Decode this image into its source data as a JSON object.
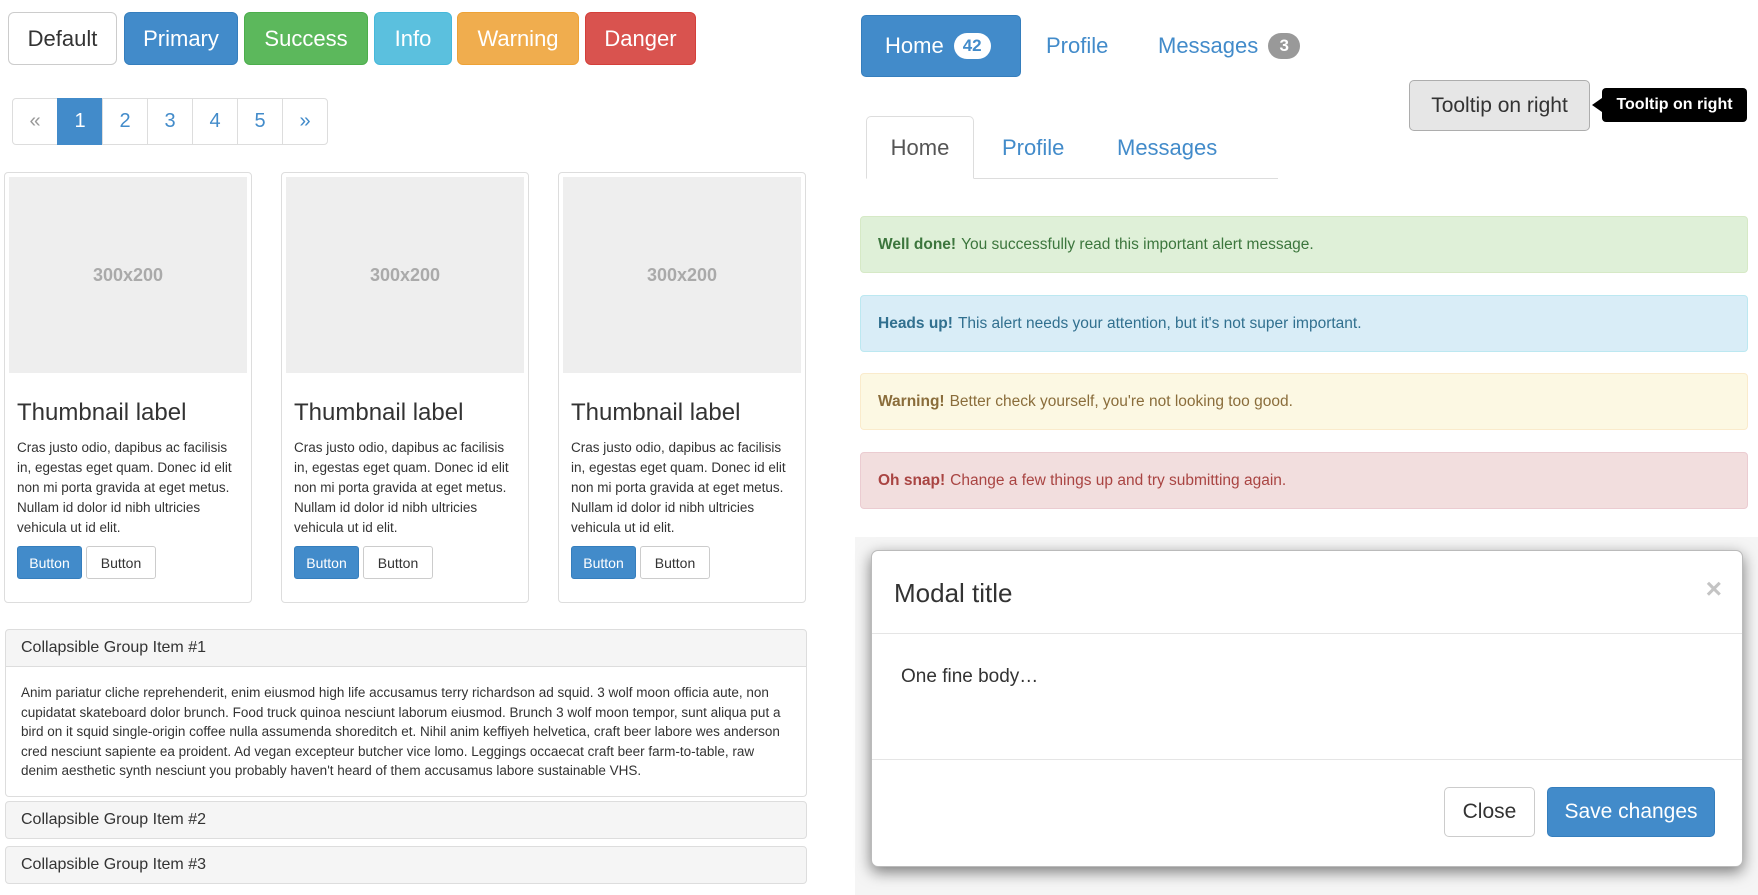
{
  "buttons": {
    "default": "Default",
    "primary": "Primary",
    "success": "Success",
    "info": "Info",
    "warning": "Warning",
    "danger": "Danger"
  },
  "pagination": {
    "prev": "«",
    "pages": [
      "1",
      "2",
      "3",
      "4",
      "5"
    ],
    "next": "»",
    "active_page": "1"
  },
  "thumbnails": [
    {
      "image_text": "300x200",
      "label": "Thumbnail label",
      "text": "Cras justo odio, dapibus ac facilisis in, egestas eget quam. Donec id elit non mi porta gravida at eget metus. Nullam id dolor id nibh ultricies vehicula ut id elit.",
      "primary_button": "Button",
      "default_button": "Button"
    },
    {
      "image_text": "300x200",
      "label": "Thumbnail label",
      "text": "Cras justo odio, dapibus ac facilisis in, egestas eget quam. Donec id elit non mi porta gravida at eget metus. Nullam id dolor id nibh ultricies vehicula ut id elit.",
      "primary_button": "Button",
      "default_button": "Button"
    },
    {
      "image_text": "300x200",
      "label": "Thumbnail label",
      "text": "Cras justo odio, dapibus ac facilisis in, egestas eget quam. Donec id elit non mi porta gravida at eget metus. Nullam id dolor id nibh ultricies vehicula ut id elit.",
      "primary_button": "Button",
      "default_button": "Button"
    }
  ],
  "accordion": {
    "items": [
      {
        "title": "Collapsible Group Item #1",
        "body": "Anim pariatur cliche reprehenderit, enim eiusmod high life accusamus terry richardson ad squid. 3 wolf moon officia aute, non cupidatat skateboard dolor brunch. Food truck quinoa nesciunt laborum eiusmod. Brunch 3 wolf moon tempor, sunt aliqua put a bird on it squid single-origin coffee nulla assumenda shoreditch et. Nihil anim keffiyeh helvetica, craft beer labore wes anderson cred nesciunt sapiente ea proident. Ad vegan excepteur butcher vice lomo. Leggings occaecat craft beer farm-to-table, raw denim aesthetic synth nesciunt you probably haven't heard of them accusamus labore sustainable VHS."
      },
      {
        "title": "Collapsible Group Item #2"
      },
      {
        "title": "Collapsible Group Item #3"
      }
    ]
  },
  "pills": {
    "home": "Home",
    "home_badge": "42",
    "profile": "Profile",
    "messages": "Messages",
    "messages_badge": "3"
  },
  "tooltip": {
    "button_label": "Tooltip on right",
    "tip_text": "Tooltip on right"
  },
  "tabs": {
    "home": "Home",
    "profile": "Profile",
    "messages": "Messages"
  },
  "alerts": {
    "success": {
      "strong": "Well done!",
      "text": "You successfully read this important alert message."
    },
    "info": {
      "strong": "Heads up!",
      "text": "This alert needs your attention, but it's not super important."
    },
    "warning": {
      "strong": "Warning!",
      "text": "Better check yourself, you're not looking too good."
    },
    "danger": {
      "strong": "Oh snap!",
      "text": "Change a few things up and try submitting again."
    }
  },
  "modal": {
    "title": "Modal title",
    "close_icon": "×",
    "body": "One fine body…",
    "close_button": "Close",
    "save_button": "Save changes"
  },
  "colors": {
    "primary": "#428bca",
    "success": "#5cb85c",
    "info": "#5bc0de",
    "warning": "#f0ad4e",
    "danger": "#d9534f"
  }
}
